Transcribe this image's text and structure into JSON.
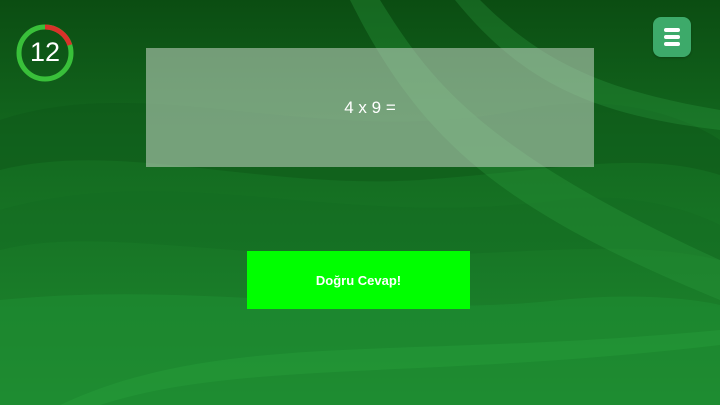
{
  "timer": {
    "value": "12",
    "progress": 0.2,
    "ring_color": "#39c03a",
    "elapsed_color": "#d9322a"
  },
  "question": {
    "text": "4 x 9 ="
  },
  "result_button": {
    "label": "Doğru Cevap!",
    "color": "#00ff00"
  },
  "menu": {
    "icon": "hamburger-menu-icon",
    "color": "#3daa6a"
  },
  "theme": {
    "background": "#1a7a28"
  }
}
